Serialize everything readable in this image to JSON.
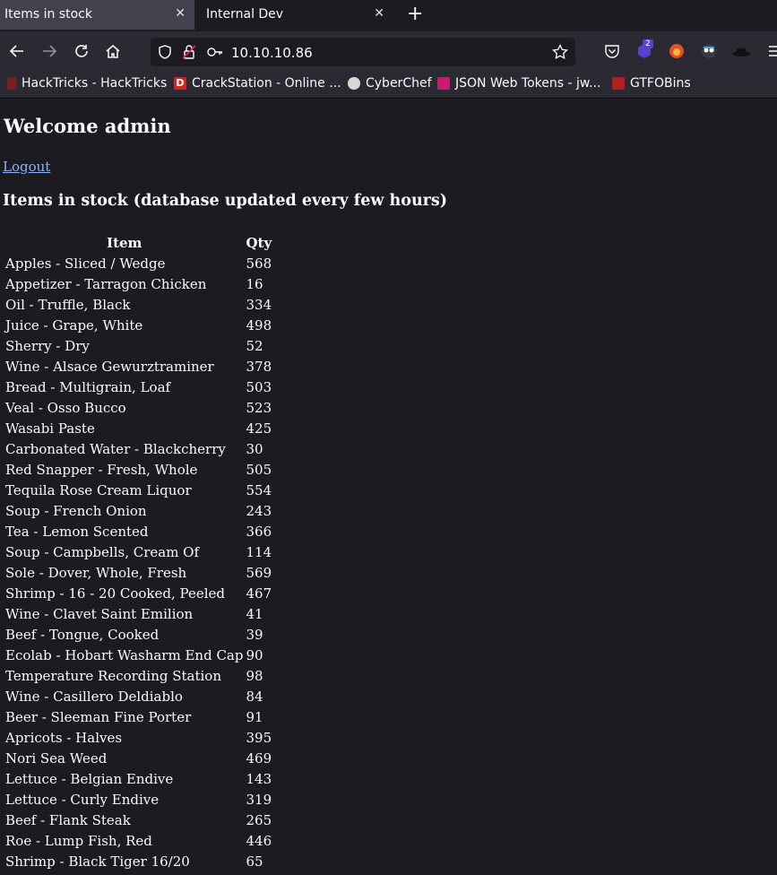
{
  "tabs": [
    {
      "label": "Items in stock",
      "active": true
    },
    {
      "label": "Internal Dev",
      "active": false
    }
  ],
  "url": "10.10.10.86",
  "bookmarks": [
    {
      "label": "HackTricks - HackTricks",
      "color": "#7a1f1f"
    },
    {
      "label": "CrackStation - Online ...",
      "color": "#d0281f"
    },
    {
      "label": "CyberChef",
      "color": "#d8d8d8"
    },
    {
      "label": "JSON Web Tokens - jw...",
      "color": "#c51e6e"
    },
    {
      "label": "GTFOBins",
      "color": "#b02020"
    }
  ],
  "page": {
    "welcome": "Welcome admin",
    "logout": "Logout",
    "subtitle": "Items in stock (database updated every few hours)",
    "headers": [
      "Item",
      "Qty"
    ],
    "rows": [
      [
        "Apples - Sliced / Wedge",
        "568"
      ],
      [
        "Appetizer - Tarragon Chicken",
        "16"
      ],
      [
        "Oil - Truffle, Black",
        "334"
      ],
      [
        "Juice - Grape, White",
        "498"
      ],
      [
        "Sherry - Dry",
        "52"
      ],
      [
        "Wine - Alsace Gewurztraminer",
        "378"
      ],
      [
        "Bread - Multigrain, Loaf",
        "503"
      ],
      [
        "Veal - Osso Bucco",
        "523"
      ],
      [
        "Wasabi Paste",
        "425"
      ],
      [
        "Carbonated Water - Blackcherry",
        "30"
      ],
      [
        "Red Snapper - Fresh, Whole",
        "505"
      ],
      [
        "Tequila Rose Cream Liquor",
        "554"
      ],
      [
        "Soup - French Onion",
        "243"
      ],
      [
        "Tea - Lemon Scented",
        "366"
      ],
      [
        "Soup - Campbells, Cream Of",
        "114"
      ],
      [
        "Sole - Dover, Whole, Fresh",
        "569"
      ],
      [
        "Shrimp - 16 - 20 Cooked, Peeled",
        "467"
      ],
      [
        "Wine - Clavet Saint Emilion",
        "41"
      ],
      [
        "Beef - Tongue, Cooked",
        "39"
      ],
      [
        "Ecolab - Hobart Washarm End Cap",
        "90"
      ],
      [
        "Temperature Recording Station",
        "98"
      ],
      [
        "Wine - Casillero Deldiablo",
        "84"
      ],
      [
        "Beer - Sleeman Fine Porter",
        "91"
      ],
      [
        "Apricots - Halves",
        "395"
      ],
      [
        "Nori Sea Weed",
        "469"
      ],
      [
        "Lettuce - Belgian Endive",
        "143"
      ],
      [
        "Lettuce - Curly Endive",
        "319"
      ],
      [
        "Beef - Flank Steak",
        "265"
      ],
      [
        "Roe - Lump Fish, Red",
        "446"
      ],
      [
        "Shrimp - Black Tiger 16/20",
        "65"
      ]
    ]
  },
  "toolbar_badge": "2"
}
